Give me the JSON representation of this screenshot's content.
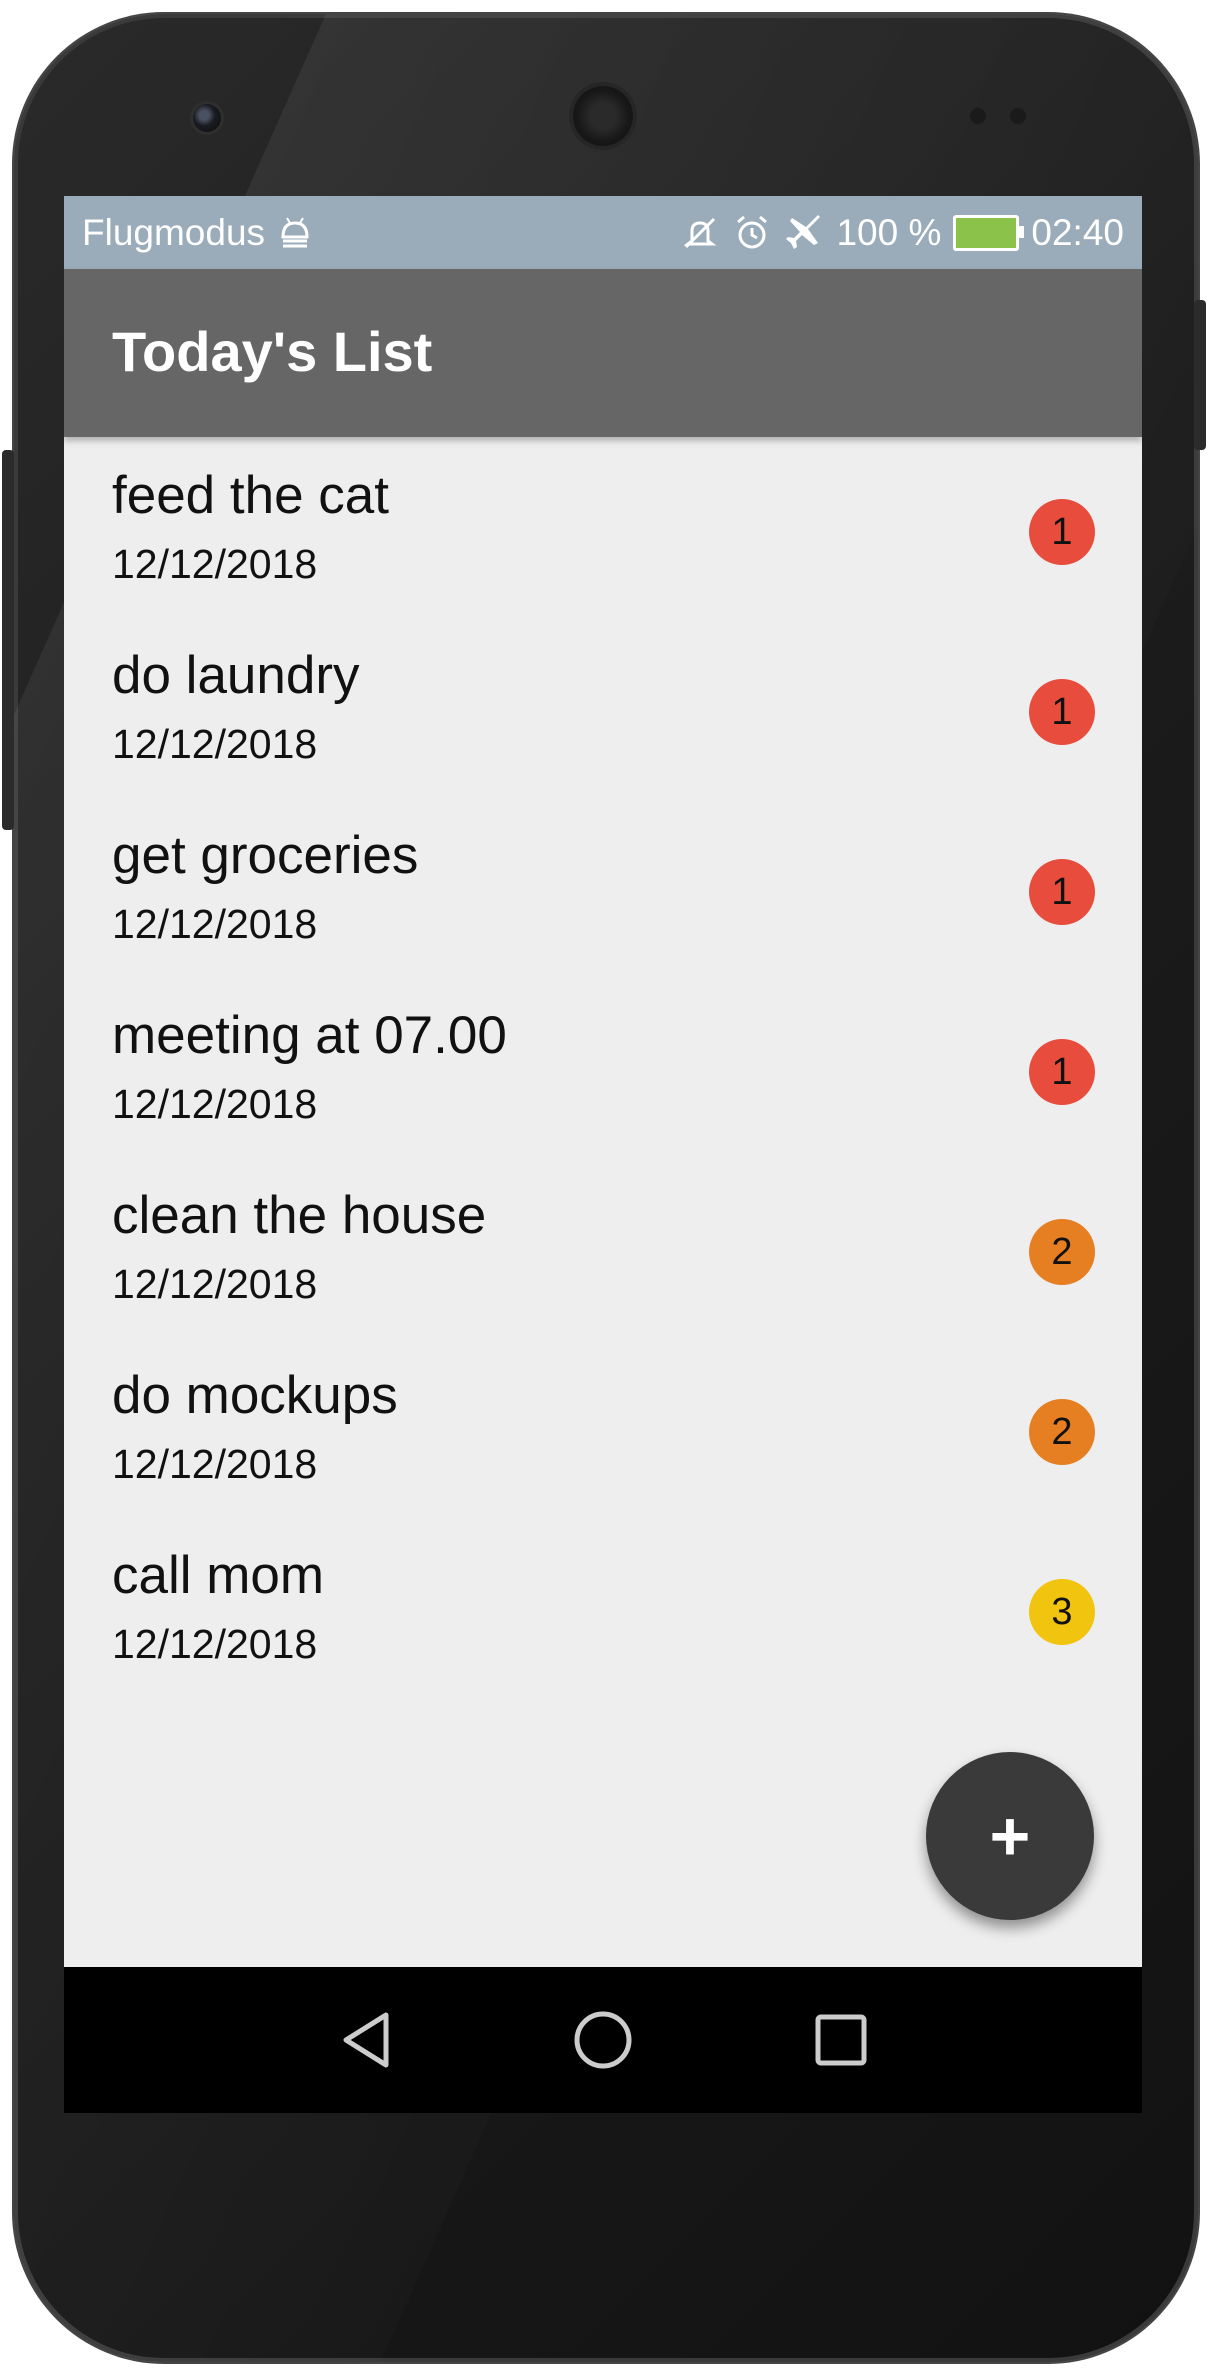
{
  "status_bar": {
    "carrier": "Flugmodus",
    "battery": "100 %",
    "time": "02:40",
    "icons": [
      "android-debug-icon",
      "mute-icon",
      "alarm-icon",
      "airplane-icon",
      "battery-icon"
    ]
  },
  "app_bar": {
    "title": "Today's List"
  },
  "tasks": [
    {
      "title": "feed the cat",
      "date": "12/12/2018",
      "priority": "1",
      "color": "#e74c3c"
    },
    {
      "title": "do laundry",
      "date": "12/12/2018",
      "priority": "1",
      "color": "#e74c3c"
    },
    {
      "title": "get groceries",
      "date": "12/12/2018",
      "priority": "1",
      "color": "#e74c3c"
    },
    {
      "title": "meeting at 07.00",
      "date": "12/12/2018",
      "priority": "1",
      "color": "#e74c3c"
    },
    {
      "title": "clean the house",
      "date": "12/12/2018",
      "priority": "2",
      "color": "#e67e22"
    },
    {
      "title": "do mockups",
      "date": "12/12/2018",
      "priority": "2",
      "color": "#e67e22"
    },
    {
      "title": "call mom",
      "date": "12/12/2018",
      "priority": "3",
      "color": "#f1c40f"
    }
  ],
  "fab": {
    "label": "+",
    "icon": "plus-icon"
  },
  "nav_bar": {
    "icons": [
      "back-icon",
      "home-icon",
      "recents-icon"
    ]
  }
}
